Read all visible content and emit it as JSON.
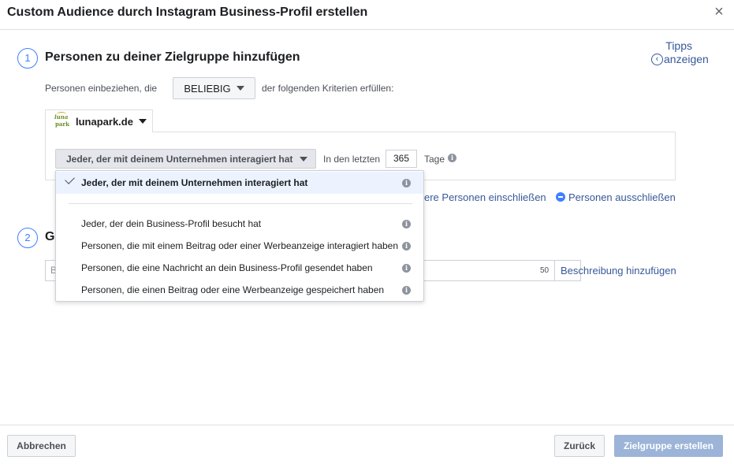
{
  "dialog": {
    "title": "Custom Audience durch Instagram Business-Profil erstellen",
    "close_glyph": "×"
  },
  "tips": {
    "line1": "Tipps",
    "line2": "anzeigen"
  },
  "step1": {
    "number": "1",
    "title": "Personen zu deiner Zielgruppe hinzufügen",
    "include_prefix": "Personen einbeziehen, die",
    "any_select": "BELIEBIG",
    "include_suffix": "der folgenden Kriterien erfüllen:",
    "source": {
      "logo_line1": "luna",
      "logo_line2": "park",
      "name": "lunapark.de"
    },
    "criteria_select": "Jeder, der mit deinem Unternehmen interagiert hat",
    "in_last_label": "In den letzten",
    "days_value": "365",
    "days_unit": "Tage",
    "include_more_link": "ere Personen einschließen",
    "exclude_link": "Personen ausschließen"
  },
  "step2": {
    "number": "2",
    "title_visible": "G",
    "name_placeholder": "B",
    "char_count": "50",
    "description_link": "Beschreibung hinzufügen"
  },
  "dropdown": {
    "selected": "Jeder, der mit deinem Unternehmen interagiert hat",
    "options": [
      "Jeder, der dein Business-Profil besucht hat",
      "Personen, die mit einem Beitrag oder einer Werbeanzeige interagiert haben",
      "Personen, die eine Nachricht an dein Business-Profil gesendet haben",
      "Personen, die einen Beitrag oder eine Werbeanzeige gespeichert haben"
    ]
  },
  "footer": {
    "cancel": "Abbrechen",
    "back": "Zurück",
    "create": "Zielgruppe erstellen"
  },
  "colors": {
    "accent": "#4080ff",
    "link": "#385898",
    "primary_disabled": "#9cb4d8",
    "dropdown_selected_bg": "#ecf3ff"
  }
}
